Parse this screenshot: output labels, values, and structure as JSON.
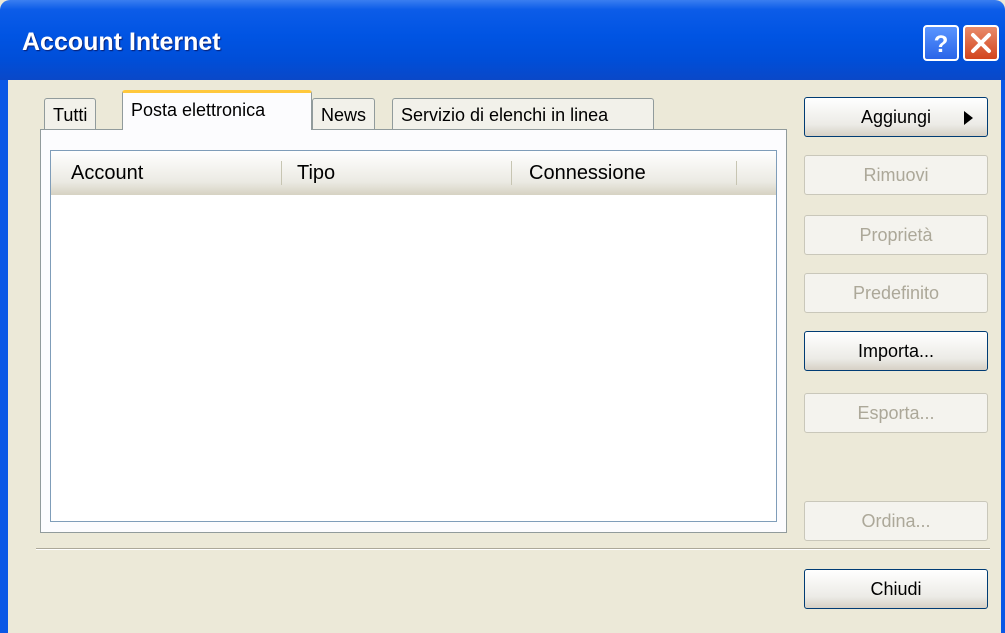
{
  "window": {
    "title": "Account Internet"
  },
  "tabs": [
    {
      "label": "Tutti"
    },
    {
      "label": "Posta elettronica"
    },
    {
      "label": "News"
    },
    {
      "label": "Servizio di elenchi in linea"
    }
  ],
  "list": {
    "columns": [
      "Account",
      "Tipo",
      "Connessione"
    ]
  },
  "buttons": {
    "add": "Aggiungi",
    "remove": "Rimuovi",
    "properties": "Proprietà",
    "default": "Predefinito",
    "import": "Importa...",
    "export": "Esporta...",
    "order": "Ordina...",
    "close": "Chiudi"
  },
  "icons": {
    "help": "help-icon",
    "close": "close-icon",
    "add_arrow": "arrow-right-icon"
  },
  "colors": {
    "titlebar": "#0054e3",
    "dialog": "#ece9d8",
    "active_tab_accent": "#ffc83c",
    "close_button": "#d2451e"
  }
}
